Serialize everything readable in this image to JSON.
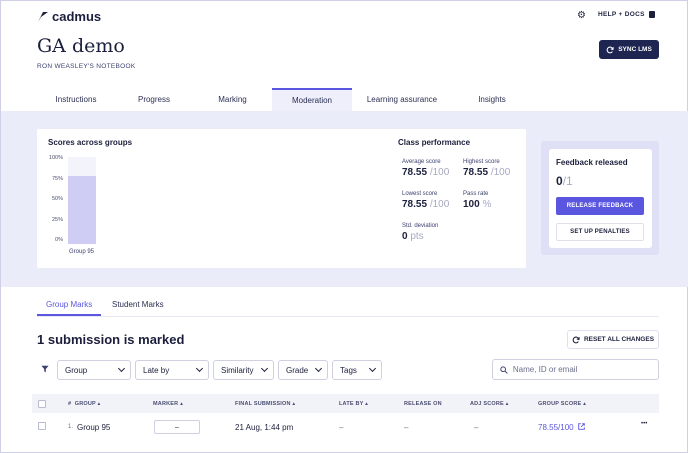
{
  "header": {
    "brand": "cadmus",
    "help_label": "HELP + DOCS",
    "title": "GA demo",
    "subtitle": "RON WEASLEY'S NOTEBOOK",
    "sync_label": "SYNC LMS"
  },
  "tabs": [
    {
      "label": "Instructions"
    },
    {
      "label": "Progress"
    },
    {
      "label": "Marking"
    },
    {
      "label": "Moderation",
      "active": true
    },
    {
      "label": "Learning assurance"
    },
    {
      "label": "Insights"
    }
  ],
  "scores_card": {
    "title": "Scores across groups",
    "chart_data": {
      "type": "bar",
      "title": "Scores across groups",
      "categories": [
        "Group 95"
      ],
      "values": [
        78.55
      ],
      "yticks": [
        "100%",
        "75%",
        "50%",
        "25%",
        "0%"
      ],
      "ylim": [
        0,
        100
      ]
    }
  },
  "class_performance": {
    "title": "Class performance",
    "average": {
      "label": "Average score",
      "value": "78.55",
      "denom": "/100"
    },
    "highest": {
      "label": "Highest score",
      "value": "78.55",
      "denom": "/100"
    },
    "lowest": {
      "label": "Lowest score",
      "value": "78.55",
      "denom": "/100"
    },
    "pass_rate": {
      "label": "Pass rate",
      "value": "100",
      "denom": "%"
    },
    "std_dev": {
      "label": "Std. deviation",
      "value": "0",
      "denom": "pts"
    }
  },
  "feedback": {
    "title": "Feedback released",
    "count": "0",
    "denom": "/1",
    "release_label": "RELEASE FEEDBACK",
    "penalties_label": "SET UP PENALTIES"
  },
  "subtabs": [
    {
      "label": "Group Marks",
      "active": true
    },
    {
      "label": "Student Marks"
    }
  ],
  "list": {
    "heading": "1 submission is marked",
    "reset_label": "RESET ALL CHANGES"
  },
  "filters": {
    "group": "Group",
    "late_by": "Late by",
    "similarity": "Similarity",
    "grade": "Grade",
    "tags": "Tags",
    "search_placeholder": "Name, ID or email"
  },
  "table": {
    "headers": {
      "num": "#",
      "group": "GROUP",
      "marker": "MARKER",
      "final_submission": "FINAL SUBMISSION",
      "late_by": "LATE BY",
      "release_on": "RELEASE ON",
      "adj_score": "ADJ SCORE",
      "group_score": "GROUP SCORE"
    },
    "rows": [
      {
        "num": "1.",
        "group": "Group 95",
        "marker": "–",
        "final_submission": "21 Aug, 1:44 pm",
        "late_by": "–",
        "release_on": "–",
        "adj_score": "–",
        "group_score": "78.55/100",
        "more": "•••"
      }
    ]
  },
  "colors": {
    "accent": "#5b56e0",
    "navy": "#1e2551",
    "band": "#ebecf9"
  }
}
